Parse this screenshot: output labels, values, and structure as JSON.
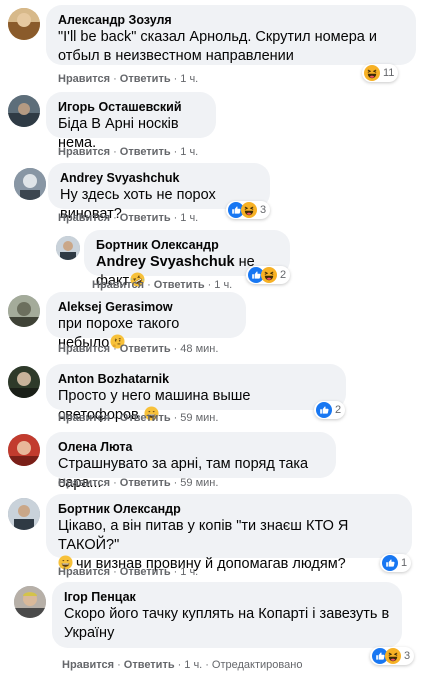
{
  "actions": {
    "like": "Нравится",
    "reply": "Ответить",
    "edited": "Отредактировано"
  },
  "comments": [
    {
      "author": "Александр Зозуля",
      "text": "\"I'll be back\" сказал Арнольд. Скрутил номера и отбыл в неизвестном направлении",
      "time": "1 ч.",
      "reactions": {
        "count": "11",
        "icons": [
          "haha"
        ]
      }
    },
    {
      "author": "Игорь Осташевский",
      "text": "Біда В Арні носків нема.",
      "time": "1 ч."
    },
    {
      "author": "Andrey Svyashchuk",
      "text": "Ну здесь хоть не порох виноват?",
      "time": "1 ч.",
      "reactions": {
        "count": "3",
        "icons": [
          "like",
          "haha"
        ]
      }
    },
    {
      "author": "Бортник Олександр",
      "mention": "Andrey Svyashchuk",
      "text": "не факт",
      "emoji": "rofl",
      "time": "1 ч.",
      "reactions": {
        "count": "2",
        "icons": [
          "like",
          "haha"
        ]
      }
    },
    {
      "author": "Aleksej Gerasimow",
      "text": "при порохе такого небыло",
      "emoji": "thinking",
      "time": "48 мин."
    },
    {
      "author": "Anton Bozhatarnik",
      "text": "Просто у него машина выше светофоров",
      "emoji": "grin",
      "time": "59 мин.",
      "reactions": {
        "count": "2",
        "icons": [
          "like"
        ]
      }
    },
    {
      "author": "Олена Люта",
      "text": "Страшнувато за арні, там поряд така сара...",
      "time": "59 мин."
    },
    {
      "author": "Бортник Олександр",
      "text": "Цікаво, а він питав у копів \"ти знаєш КТО Я ТАКОЙ?\"",
      "emoji_lead": "grin",
      "text2": "чи визнав провину й допомагав людям?",
      "time": "1 ч.",
      "reactions": {
        "count": "1",
        "icons": [
          "like"
        ]
      }
    },
    {
      "author": "Ігор Пенцак",
      "text": "Скоро його тачку куплять на Копарті і завезуть в Україну",
      "time": "1 ч.",
      "edited": true,
      "reactions": {
        "count": "3",
        "icons": [
          "like",
          "haha"
        ]
      }
    }
  ],
  "colors": {
    "bubble": "#f0f2f5",
    "meta": "#65676b",
    "like_blue": "#1877f2",
    "haha_yellow": "#f7b125"
  }
}
